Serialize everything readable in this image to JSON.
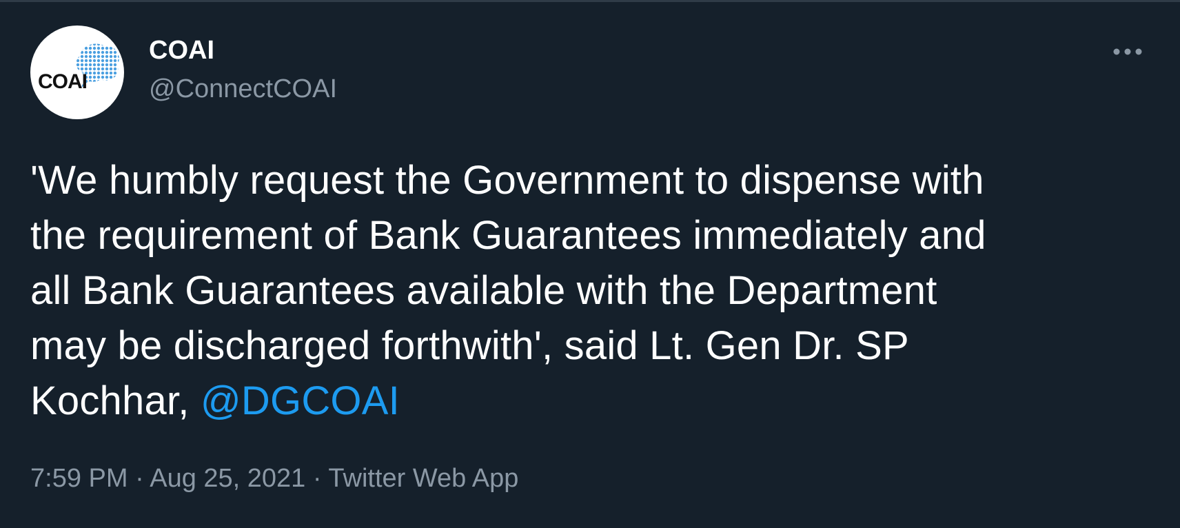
{
  "author": {
    "display_name": "COAI",
    "handle": "@ConnectCOAI",
    "avatar_text": "COAI"
  },
  "tweet": {
    "lines": [
      "'We humbly request the Government to dispense with",
      "the requirement of Bank Guarantees immediately and",
      "all Bank Guarantees available with the Department",
      "may be discharged forthwith', said Lt. Gen Dr. SP"
    ],
    "last_line_prefix": "Kochhar, ",
    "mention": "@DGCOAI"
  },
  "meta": {
    "time": "7:59 PM",
    "separator": "·",
    "date": "Aug 25, 2021",
    "source": "Twitter Web App"
  },
  "icons": {
    "more": "more-horizontal-icon"
  },
  "colors": {
    "background": "#15202b",
    "text": "#ffffff",
    "secondary": "#8b98a5",
    "accent": "#1d9bf0"
  }
}
